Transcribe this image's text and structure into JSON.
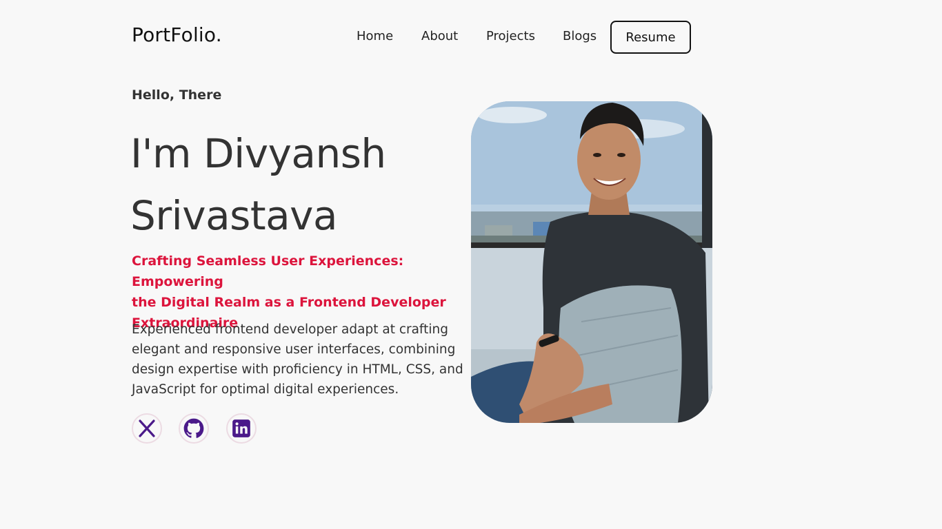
{
  "header": {
    "logo": "PortFolio.",
    "nav": [
      "Home",
      "About",
      "Projects",
      "Blogs"
    ],
    "resume_label": "Resume"
  },
  "hero": {
    "greeting": "Hello, There",
    "name_line1": "I'm Divyansh",
    "name_line2": "Srivastava",
    "tagline_line1": "Crafting Seamless User Experiences: Empowering",
    "tagline_line2": "the Digital Realm as a Frontend Developer",
    "tagline_line3": "Extraordinaire",
    "desc_line1": "Experienced frontend developer adapt at crafting",
    "desc_line2": "elegant and responsive user interfaces, combining",
    "desc_line3": "design expertise with proficiency in HTML, CSS, and",
    "desc_line4": "JavaScript for optimal digital experiences."
  },
  "social": [
    {
      "icon": "x-twitter-icon"
    },
    {
      "icon": "github-icon"
    },
    {
      "icon": "linkedin-icon"
    }
  ],
  "colors": {
    "accent": "#dc143c",
    "icon": "#4b1a8a",
    "text": "#333333",
    "background": "#f8f8f8"
  }
}
